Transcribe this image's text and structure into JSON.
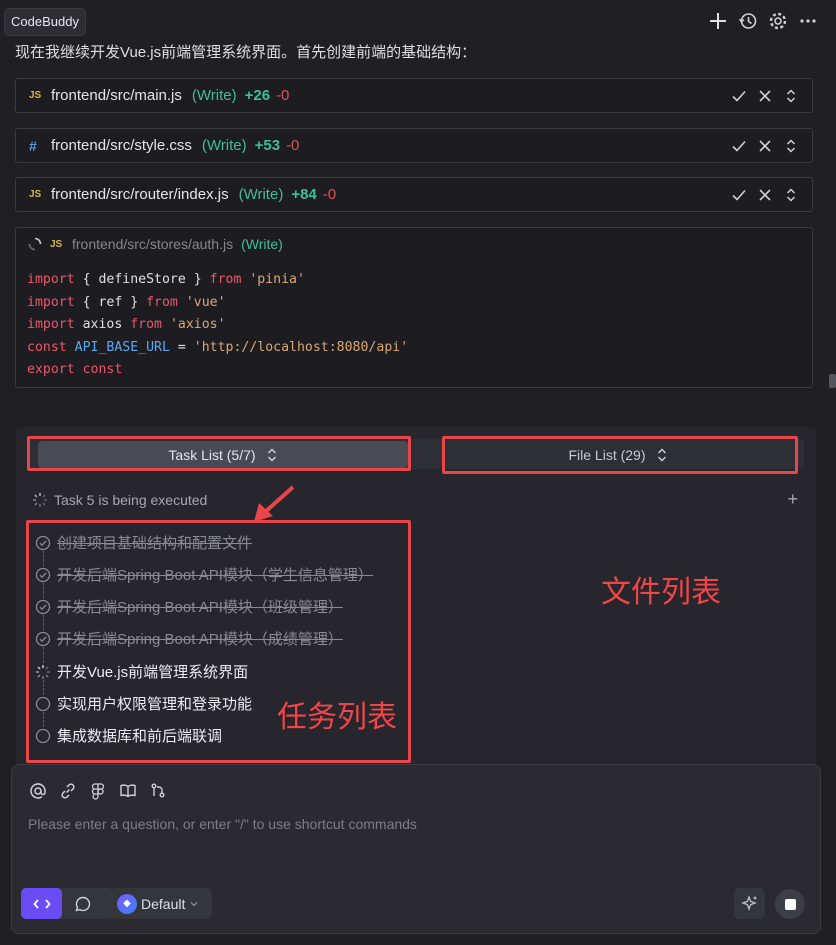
{
  "header": {
    "app_name": "CodeBuddy",
    "actions": [
      "plus-icon",
      "history-icon",
      "gear-icon",
      "more-icon"
    ]
  },
  "message": {
    "intro": "现在我继续开发Vue.js前端管理系统界面。首先创建前端的基础结构："
  },
  "files": [
    {
      "type": "JS",
      "name": "frontend/src/main.js",
      "action": "(Write)",
      "added": "+26",
      "removed": "-0"
    },
    {
      "type": "#",
      "name": "frontend/src/style.css",
      "action": "(Write)",
      "added": "+53",
      "removed": "-0"
    },
    {
      "type": "JS",
      "name": "frontend/src/router/index.js",
      "action": "(Write)",
      "added": "+84",
      "removed": "-0"
    }
  ],
  "code_card": {
    "type": "JS",
    "name": "frontend/src/stores/auth.js",
    "action": "(Write)",
    "lines": [
      [
        {
          "t": "import",
          "c": "kw"
        },
        {
          "t": " { defineStore } ",
          "c": ""
        },
        {
          "t": "from",
          "c": "kw"
        },
        {
          "t": " ",
          "c": ""
        },
        {
          "t": "'pinia'",
          "c": "str"
        }
      ],
      [
        {
          "t": "import",
          "c": "kw"
        },
        {
          "t": " { ref } ",
          "c": ""
        },
        {
          "t": "from",
          "c": "kw"
        },
        {
          "t": " ",
          "c": ""
        },
        {
          "t": "'vue'",
          "c": "str"
        }
      ],
      [
        {
          "t": "import",
          "c": "kw"
        },
        {
          "t": " axios ",
          "c": ""
        },
        {
          "t": "from",
          "c": "kw"
        },
        {
          "t": " ",
          "c": ""
        },
        {
          "t": "'axios'",
          "c": "str"
        }
      ],
      [
        {
          "t": "const",
          "c": "kw"
        },
        {
          "t": " ",
          "c": ""
        },
        {
          "t": "API_BASE_URL",
          "c": "cst"
        },
        {
          "t": " = ",
          "c": ""
        },
        {
          "t": "'http://localhost:8080/api'",
          "c": "str"
        }
      ],
      [
        {
          "t": "export",
          "c": "kw"
        },
        {
          "t": " ",
          "c": ""
        },
        {
          "t": "const",
          "c": "kw"
        }
      ]
    ]
  },
  "panel": {
    "task_tab": "Task List (5/7)",
    "file_tab": "File List (29)",
    "status": "Task 5 is being executed",
    "tasks": [
      {
        "label": "创建项目基础结构和配置文件",
        "state": "done"
      },
      {
        "label": "开发后端Spring Boot API模块（学生信息管理）",
        "state": "done"
      },
      {
        "label": "开发后端Spring Boot API模块（班级管理）",
        "state": "done"
      },
      {
        "label": "开发后端Spring Boot API模块（成绩管理）",
        "state": "done"
      },
      {
        "label": "开发Vue.js前端管理系统界面",
        "state": "active"
      },
      {
        "label": "实现用户权限管理和登录功能",
        "state": "pending"
      },
      {
        "label": "集成数据库和前后端联调",
        "state": "pending"
      }
    ]
  },
  "annotations": {
    "file_list": "文件列表",
    "task_list": "任务列表",
    "color": "#e8464a"
  },
  "input": {
    "placeholder": "Please enter a question, or enter \"/\" to use shortcut commands",
    "tools": [
      "at-icon",
      "link-icon",
      "figma-icon",
      "book-icon",
      "branch-icon"
    ],
    "model": "Default",
    "accent": "#6a4cf5"
  }
}
